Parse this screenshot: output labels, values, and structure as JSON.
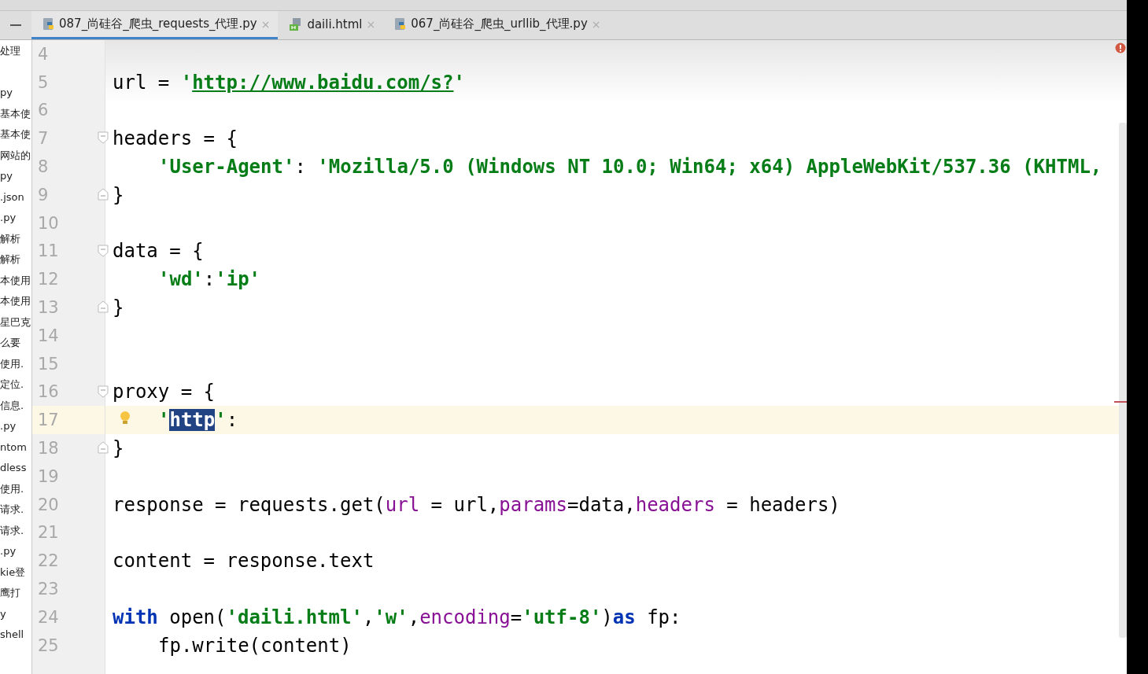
{
  "tabs": [
    {
      "label": "087_尚硅谷_爬虫_requests_代理.py",
      "close": "×",
      "kind": "python",
      "selected": true
    },
    {
      "label": "daili.html",
      "close": "×",
      "kind": "html",
      "selected": false
    },
    {
      "label": "067_尚硅谷_爬虫_urllib_代理.py",
      "close": "×",
      "kind": "python",
      "selected": false
    }
  ],
  "sidebar": {
    "items": [
      "处理",
      "py",
      "基本使",
      "基本使",
      "网站的",
      "py",
      ".json",
      ".py",
      "解析",
      "解析",
      "本使用",
      "本使用",
      "星巴克",
      "么要",
      "使用.",
      "定位.",
      "信息.",
      ".py",
      "ntom",
      "dless",
      "使用.",
      "请求.",
      "请求.",
      ".py",
      "kie登",
      "鹰打",
      "y",
      "shell"
    ]
  },
  "editor": {
    "lines": [
      {
        "number": "4",
        "current": false
      },
      {
        "number": "5",
        "current": false,
        "indent": false,
        "tokens": [
          {
            "kind": "plain",
            "text": "url = "
          },
          {
            "kind": "string",
            "text": "'"
          },
          {
            "kind": "link",
            "text": "http://www.baidu.com/s?"
          },
          {
            "kind": "string",
            "text": "'"
          }
        ]
      },
      {
        "number": "6",
        "current": false
      },
      {
        "number": "7",
        "current": false,
        "fold": {
          "start": true
        },
        "indent": false,
        "tokens": [
          {
            "kind": "plain",
            "text": "headers = {"
          }
        ]
      },
      {
        "number": "8",
        "current": false,
        "indent": true,
        "tokens": [
          {
            "kind": "string",
            "text": "'User-Agent'"
          },
          {
            "kind": "plain",
            "text": ": "
          },
          {
            "kind": "string",
            "text": "'Mozilla/5.0 (Windows NT 10.0; Win64; x64) AppleWebKit/537.36 (KHTML,"
          }
        ]
      },
      {
        "number": "9",
        "current": false,
        "fold": {
          "start": false
        },
        "indent": false,
        "tokens": [
          {
            "kind": "plain",
            "text": "}"
          }
        ]
      },
      {
        "number": "10",
        "current": false
      },
      {
        "number": "11",
        "current": false,
        "fold": {
          "start": true
        },
        "indent": false,
        "tokens": [
          {
            "kind": "plain",
            "text": "data = {"
          }
        ]
      },
      {
        "number": "12",
        "current": false,
        "indent": true,
        "tokens": [
          {
            "kind": "string",
            "text": "'wd'"
          },
          {
            "kind": "plain",
            "text": ":"
          },
          {
            "kind": "string",
            "text": "'ip'"
          }
        ]
      },
      {
        "number": "13",
        "current": false,
        "fold": {
          "start": false
        },
        "indent": false,
        "tokens": [
          {
            "kind": "plain",
            "text": "}"
          }
        ]
      },
      {
        "number": "14",
        "current": false
      },
      {
        "number": "15",
        "current": false
      },
      {
        "number": "16",
        "current": false,
        "fold": {
          "start": true
        },
        "indent": false,
        "tokens": [
          {
            "kind": "plain",
            "text": "proxy = {"
          }
        ]
      },
      {
        "number": "17",
        "current": true,
        "indent": true,
        "tokens": [
          {
            "kind": "string",
            "text": "'"
          },
          {
            "kind": "selected",
            "text": "http"
          },
          {
            "kind": "string",
            "text": "'"
          },
          {
            "kind": "plain",
            "text": ":"
          }
        ]
      },
      {
        "number": "18",
        "current": false,
        "fold": {
          "start": false
        },
        "indent": false,
        "tokens": [
          {
            "kind": "plain",
            "text": "}"
          }
        ]
      },
      {
        "number": "19",
        "current": false
      },
      {
        "number": "20",
        "current": false,
        "indent": false,
        "tokens": [
          {
            "kind": "plain",
            "text": "response = requests.get("
          },
          {
            "kind": "param",
            "text": "url"
          },
          {
            "kind": "plain",
            "text": " = url,"
          },
          {
            "kind": "param",
            "text": "params"
          },
          {
            "kind": "plain",
            "text": "=data,"
          },
          {
            "kind": "param",
            "text": "headers"
          },
          {
            "kind": "plain",
            "text": " = headers)"
          }
        ]
      },
      {
        "number": "21",
        "current": false
      },
      {
        "number": "22",
        "current": false,
        "indent": false,
        "tokens": [
          {
            "kind": "plain",
            "text": "content = response.text"
          }
        ]
      },
      {
        "number": "23",
        "current": false
      },
      {
        "number": "24",
        "current": false,
        "indent": false,
        "tokens": [
          {
            "kind": "keyword",
            "text": "with"
          },
          {
            "kind": "plain",
            "text": " open("
          },
          {
            "kind": "string",
            "text": "'daili.html'"
          },
          {
            "kind": "plain",
            "text": ","
          },
          {
            "kind": "string",
            "text": "'w'"
          },
          {
            "kind": "plain",
            "text": ","
          },
          {
            "kind": "param",
            "text": "encoding"
          },
          {
            "kind": "plain",
            "text": "="
          },
          {
            "kind": "string",
            "text": "'utf-8'"
          },
          {
            "kind": "plain",
            "text": ")"
          },
          {
            "kind": "keyword",
            "text": "as"
          },
          {
            "kind": "plain",
            "text": " fp:"
          }
        ]
      },
      {
        "number": "25",
        "current": false,
        "indent": true,
        "tokens": [
          {
            "kind": "plain",
            "text": "fp.write(content)"
          }
        ]
      }
    ]
  }
}
